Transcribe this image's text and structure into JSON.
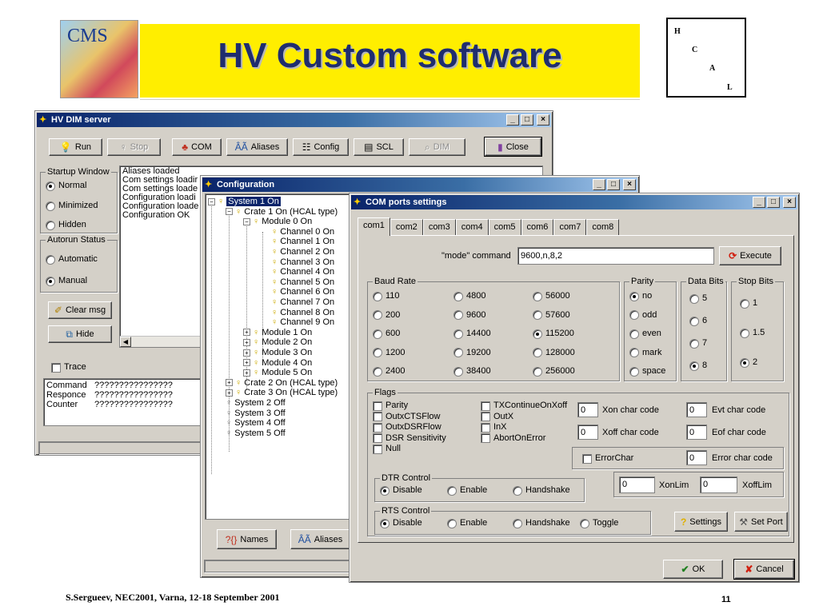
{
  "slide": {
    "title": "HV Custom software",
    "logo_text": "CMS",
    "hcal_letters": [
      "H",
      "C",
      "A",
      "L"
    ],
    "footer_left": "S.Sergueev, NEC2001, Varna, 12-18 September 2001",
    "page_number": "11"
  },
  "dim_server": {
    "title": "HV DIM server",
    "toolbar": {
      "run": "Run",
      "stop": "Stop",
      "com": "COM",
      "aliases": "Aliases",
      "config": "Config",
      "scl": "SCL",
      "dim": "DIM",
      "close": "Close"
    },
    "startup_window": {
      "label": "Startup Window",
      "options": [
        "Normal",
        "Minimized",
        "Hidden"
      ],
      "selected": "Normal"
    },
    "autorun_status": {
      "label": "Autorun Status",
      "options": [
        "Automatic",
        "Manual"
      ],
      "selected": "Manual"
    },
    "clear_msg": "Clear msg",
    "hide": "Hide",
    "log": [
      "Aliases loaded",
      "Com settings loadir",
      "Com settings loade",
      "Configuration loadi",
      "Configuration loade",
      "Configuration OK"
    ],
    "trace_label": "Trace",
    "info_rows": [
      {
        "label": "Command",
        "value": "????????????????"
      },
      {
        "label": "Responce",
        "value": "????????????????"
      },
      {
        "label": "Counter",
        "value": "????????????????"
      }
    ]
  },
  "configuration": {
    "title": "Configuration",
    "tree": {
      "system1": "System 1 On",
      "crate1": "Crate 1 On (HCAL type)",
      "module0": "Module 0 On",
      "channels": [
        "Channel 0 On",
        "Channel 1 On",
        "Channel 2 On",
        "Channel 3 On",
        "Channel 4 On",
        "Channel 5 On",
        "Channel 6 On",
        "Channel 7 On",
        "Channel 8 On",
        "Channel 9 On"
      ],
      "modules": [
        "Module 1 On",
        "Module 2 On",
        "Module 3 On",
        "Module 4 On",
        "Module 5 On"
      ],
      "crates": [
        "Crate 2 On (HCAL type)",
        "Crate 3 On (HCAL type)"
      ],
      "systems_off": [
        "System 2 Off",
        "System 3 Off",
        "System 4 Off",
        "System 5 Off"
      ]
    },
    "names_button": "Names",
    "aliases_button": "Aliases"
  },
  "com_ports": {
    "title": "COM ports settings",
    "tabs": [
      "com1",
      "com2",
      "com3",
      "com4",
      "com5",
      "com6",
      "com7",
      "com8"
    ],
    "active_tab": "com1",
    "mode_label": "\"mode\" command",
    "mode_value": "9600,n,8,2",
    "execute": "Execute",
    "baud_rate": {
      "label": "Baud Rate",
      "col1": [
        "110",
        "200",
        "600",
        "1200",
        "2400"
      ],
      "col2": [
        "4800",
        "9600",
        "14400",
        "19200",
        "38400"
      ],
      "col3": [
        "56000",
        "57600",
        "115200",
        "128000",
        "256000"
      ],
      "selected": "115200"
    },
    "parity": {
      "label": "Parity",
      "options": [
        "no",
        "odd",
        "even",
        "mark",
        "space"
      ],
      "selected": "no"
    },
    "data_bits": {
      "label": "Data Bits",
      "options": [
        "5",
        "6",
        "7",
        "8"
      ],
      "selected": "8"
    },
    "stop_bits": {
      "label": "Stop Bits",
      "options": [
        "1",
        "1.5",
        "2"
      ],
      "selected": "2"
    },
    "flags": {
      "label": "Flags",
      "col1": [
        "Parity",
        "OutxCTSFlow",
        "OutxDSRFlow",
        "DSR Sensitivity",
        "Null"
      ],
      "col2": [
        "TXContinueOnXoff",
        "OutX",
        "InX",
        "AbortOnError"
      ],
      "xon_value": "0",
      "xon_label": "Xon char code",
      "xoff_value": "0",
      "xoff_label": "Xoff char code",
      "evt_value": "0",
      "evt_label": "Evt char code",
      "eof_value": "0",
      "eof_label": "Eof char code",
      "errorchar_label": "ErrorChar",
      "error_value": "0",
      "error_label": "Error char code"
    },
    "dtr": {
      "label": "DTR Control",
      "options": [
        "Disable",
        "Enable",
        "Handshake"
      ],
      "selected": "Disable"
    },
    "xonlim_value": "0",
    "xonlim_label": "XonLim",
    "xofflim_value": "0",
    "xofflim_label": "XoffLim",
    "rts": {
      "label": "RTS Control",
      "options": [
        "Disable",
        "Enable",
        "Handshake",
        "Toggle"
      ],
      "selected": "Disable"
    },
    "settings": "Settings",
    "set_port": "Set Port",
    "ok": "OK",
    "cancel": "Cancel"
  }
}
